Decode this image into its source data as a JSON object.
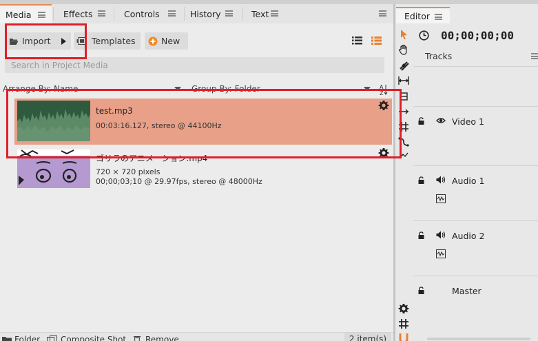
{
  "media_panel": {
    "tabs": [
      {
        "label": "Media",
        "active": true
      },
      {
        "label": "Effects",
        "active": false
      },
      {
        "label": "Controls",
        "active": false
      },
      {
        "label": "History",
        "active": false
      },
      {
        "label": "Text",
        "active": false
      }
    ],
    "toolbar": {
      "import_label": "Import",
      "templates_label": "Templates",
      "new_label": "New"
    },
    "search_placeholder": "Search in Project Media",
    "sort": {
      "arrange_label": "Arrange By: Name",
      "group_label": "Group By: Folder"
    },
    "items": [
      {
        "name": "test.mp3",
        "line1": "00:03:16.127, stereo @ 44100Hz",
        "line2": "",
        "selected": true
      },
      {
        "name": "ゴリラのアニメーション.mp4",
        "line1": "720 × 720 pixels",
        "line2": "00;00;03;10 @ 29.97fps, stereo @ 48000Hz",
        "selected": false
      }
    ],
    "bottom": {
      "folder_label": "Folder",
      "composite_label": "Composite Shot",
      "remove_label": "Remove",
      "count_label": "2 item(s)"
    }
  },
  "editor_panel": {
    "tab_label": "Editor",
    "timecode": "00;00;00;00",
    "tracks_header": "Tracks",
    "tracks": [
      {
        "name": "Video 1",
        "kind": "video"
      },
      {
        "name": "Audio 1",
        "kind": "audio"
      },
      {
        "name": "Audio 2",
        "kind": "audio"
      },
      {
        "name": "Master",
        "kind": "master"
      }
    ]
  },
  "colors": {
    "accent": "#e88a55",
    "selected_row": "#e8a088",
    "annotation": "#e01e28",
    "plus_icon": "#f08a24"
  }
}
